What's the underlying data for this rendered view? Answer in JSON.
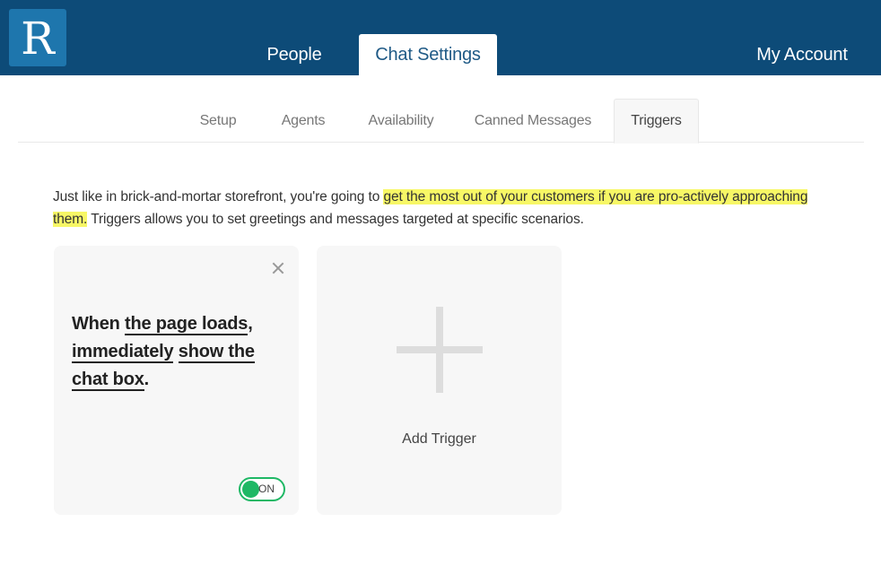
{
  "logo": {
    "letter": "R"
  },
  "nav": {
    "people": "People",
    "chat_settings": "Chat Settings",
    "my_account": "My Account"
  },
  "subtabs": {
    "setup": "Setup",
    "agents": "Agents",
    "availability": "Availability",
    "canned_messages": "Canned Messages",
    "triggers": "Triggers"
  },
  "intro": {
    "before": "Just like in brick-and-mortar storefront, you're going to ",
    "highlight_1": "get the most out of your customers if you are pro-actively approaching",
    "highlight_2": "them.",
    "after": " Triggers allows you to set greetings and messages targeted at specific scenarios."
  },
  "trigger_card": {
    "when": "When",
    "event": "the page loads",
    "timing": "immediately",
    "action": "show the chat box",
    "toggle_label": "ON",
    "toggle_on": true
  },
  "add_card": {
    "label": "Add Trigger"
  },
  "colors": {
    "header": "#0d4b78",
    "logo_bg": "#1e76ad",
    "highlight": "#f7f766",
    "toggle": "#1fb865"
  },
  "icons": {
    "close": "close-icon",
    "add": "plus-icon"
  }
}
